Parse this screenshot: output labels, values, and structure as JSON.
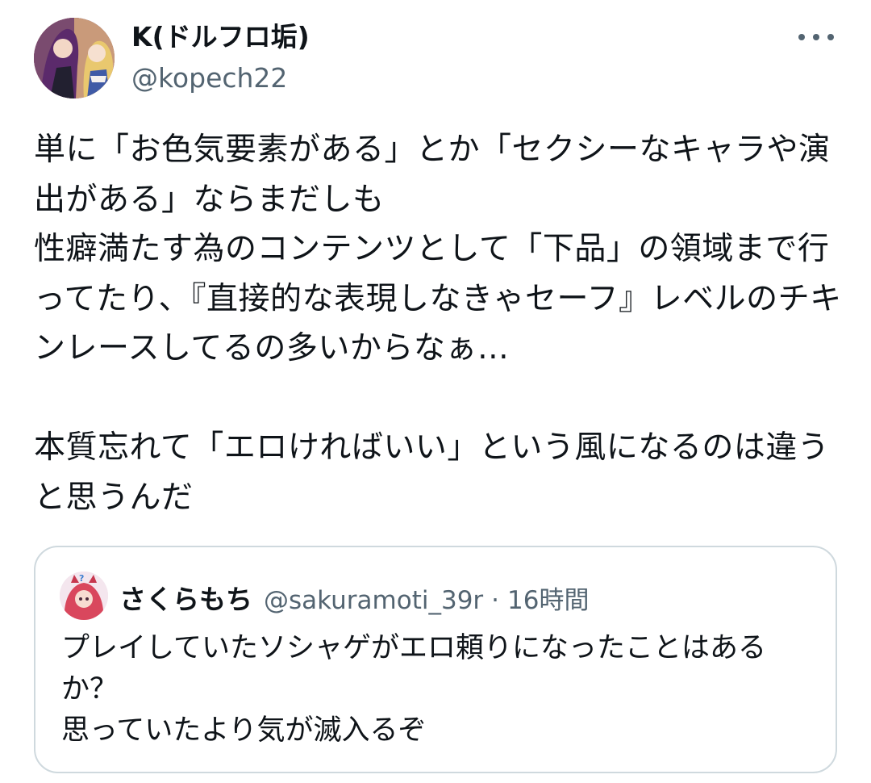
{
  "author": {
    "display_name": "K(ドルフロ垢)",
    "handle": "@kopech22",
    "avatar_icon": "anime-character-avatar"
  },
  "more_icon": "more-horizontal-icon",
  "tweet_text": "単に「お色気要素がある」とか「セクシーなキャラや演出がある」ならまだしも\n性癖満たす為のコンテンツとして「下品」の領域まで行ってたり、『直接的な表現しなきゃセーフ』レベルのチキンレースしてるの多いからなぁ…\n\n本質忘れて「エロければいい」という風になるのは違うと思うんだ",
  "quote": {
    "display_name": "さくらもち",
    "handle": "@sakuramoti_39r",
    "separator": "·",
    "time": "16時間",
    "text": "プレイしていたソシャゲがエロ頼りになったことはあるか？\n思っていたより気が滅入るぞ",
    "avatar_icon": "pink-haired-character-avatar"
  },
  "colors": {
    "primary_text": "#0f1419",
    "secondary_text": "#536471",
    "border": "#cfd9de"
  }
}
